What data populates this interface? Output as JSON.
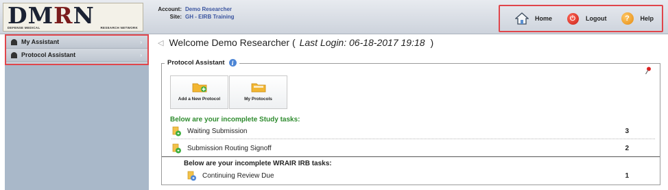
{
  "header": {
    "logo_text_part1": "DM",
    "logo_text_part2": "R",
    "logo_text_part3": "N",
    "logo_sub_left": "DEFENSE MEDICAL",
    "logo_sub_right": "RESEARCH NETWORK",
    "account_label": "Account:",
    "account_value": "Demo Researcher",
    "site_label": "Site:",
    "site_value": "GH - EIRB Training"
  },
  "topnav": {
    "home": {
      "label": "Home",
      "icon": "home-icon"
    },
    "logout": {
      "label": "Logout",
      "icon": "power-icon",
      "glyph": "⏻"
    },
    "help": {
      "label": "Help",
      "icon": "help-icon",
      "glyph": "?"
    }
  },
  "sidebar": {
    "items": [
      {
        "label": "My Assistant",
        "icon": "bullet-icon"
      },
      {
        "label": "Protocol Assistant",
        "icon": "bullet-icon"
      }
    ],
    "chevron": "›"
  },
  "main": {
    "collapse_glyph": "◁",
    "welcome": "Welcome Demo Researcher (",
    "last_login": "Last Login: 06-18-2017 19:18",
    "close_paren": ")"
  },
  "panel": {
    "title": "Protocol Assistant",
    "info_glyph": "i",
    "tiles": [
      {
        "label": "Add a New Protocol",
        "icon": "add-folder-icon"
      },
      {
        "label": "My Protocols",
        "icon": "folder-icon"
      }
    ],
    "study_heading": "Below are your incomplete Study tasks:",
    "study_tasks": [
      {
        "label": "Waiting Submission",
        "count": "3"
      },
      {
        "label": "Submission Routing Signoff",
        "count": "2"
      }
    ],
    "irb_heading": "Below are your incomplete WRAIR IRB tasks:",
    "irb_tasks": [
      {
        "label": "Continuing Review Due",
        "count": "1"
      }
    ]
  },
  "colors": {
    "highlight": "#e0454b",
    "sidebar_bg": "#a9b8c9",
    "study_heading": "#2e8b2e",
    "account_value": "#3b55a0"
  }
}
